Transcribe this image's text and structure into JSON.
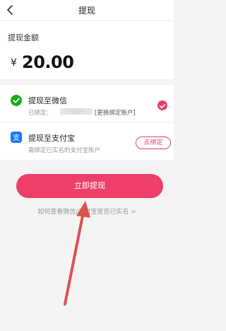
{
  "nav": {
    "title": "提现"
  },
  "amount": {
    "label": "提现金额",
    "currency": "¥",
    "value": "20.00"
  },
  "methods": [
    {
      "title": "提现至微信",
      "status_prefix": "已绑定：",
      "action_label": "[更换绑定账户]",
      "selected": true,
      "icon": "wechat-icon"
    },
    {
      "title": "提现至支付宝",
      "status": "需绑定已实名的支付宝账户",
      "button_label": "去绑定",
      "icon": "alipay-icon"
    }
  ],
  "withdraw_button": {
    "label": "立即提现"
  },
  "help_link": {
    "label": "如何查看微信/支付宝是否已实名 >"
  },
  "colors": {
    "accent": "#ee3f6a",
    "wechat": "#1aad19",
    "alipay": "#1677ff",
    "annotation_arrow": "#d9534f"
  }
}
